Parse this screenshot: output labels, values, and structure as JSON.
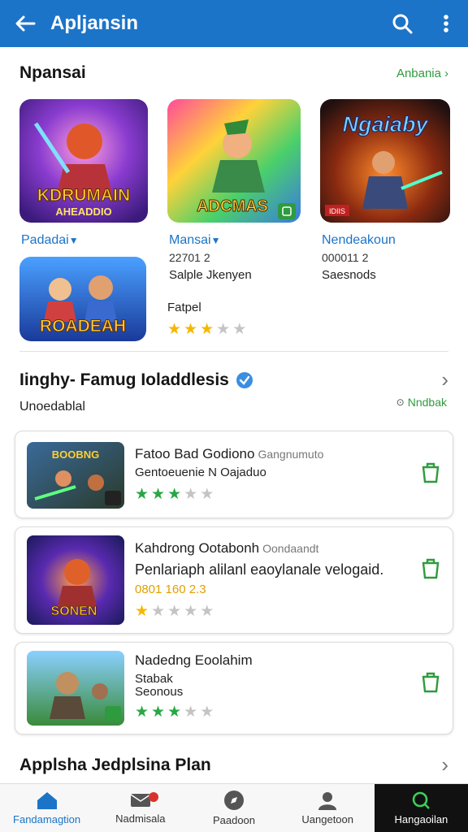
{
  "appbar": {
    "title": "Apljansin"
  },
  "section1": {
    "title": "Npansai",
    "link": "Anbania",
    "tiles": [
      {
        "label": "Padadai",
        "art_text": "KDRUMAIN",
        "art_sub": "AHEADDIO"
      },
      {
        "label": "Mansai",
        "art_text": "ADCMAS",
        "line1": "22701 2",
        "line2": "Salple Jkenyen"
      },
      {
        "label": "Nendeakoun",
        "art_text": "Ngaiaby",
        "badge": "IDIIS",
        "line1": "000011 2",
        "line2": "Saesnods"
      },
      {
        "art_text": "ROADEAH",
        "caption": "Fatpel",
        "rating": 3
      }
    ]
  },
  "section2": {
    "title": "Iinghy- Famug Ioladdlesis",
    "subtitle": "Unoedablal",
    "link": "Nndbak",
    "cards": [
      {
        "title": "Fatoo Bad Godiono",
        "developer": "Gangnumuto",
        "line1": "Gentoeuenie N Oajaduo",
        "rating": 3,
        "art_text": "BOOBNG"
      },
      {
        "title": "Kahdrong Ootabonh",
        "developer": "Oondaandt",
        "line1": "Penlariaph alilanl eaoylanale velogaid.",
        "line2": "0801 160 2.3",
        "rating": 1,
        "art_text": "SONEN"
      },
      {
        "title": "Nadedng Eoolahim",
        "line1": "Stabak",
        "line2": "Seonous",
        "rating": 3
      }
    ]
  },
  "section3": {
    "title": "Applsha Jedplsina Plan"
  },
  "nav": [
    {
      "label": "Fandamagtion"
    },
    {
      "label": "Nadmisala"
    },
    {
      "label": "Paadoon"
    },
    {
      "label": "Uangetoon"
    },
    {
      "label": "Hangaoilan"
    }
  ],
  "colors": {
    "primary": "#1c74c8",
    "accent_green": "#2e9b3e",
    "star_green": "#28a745",
    "star_gold": "#f5b800"
  }
}
